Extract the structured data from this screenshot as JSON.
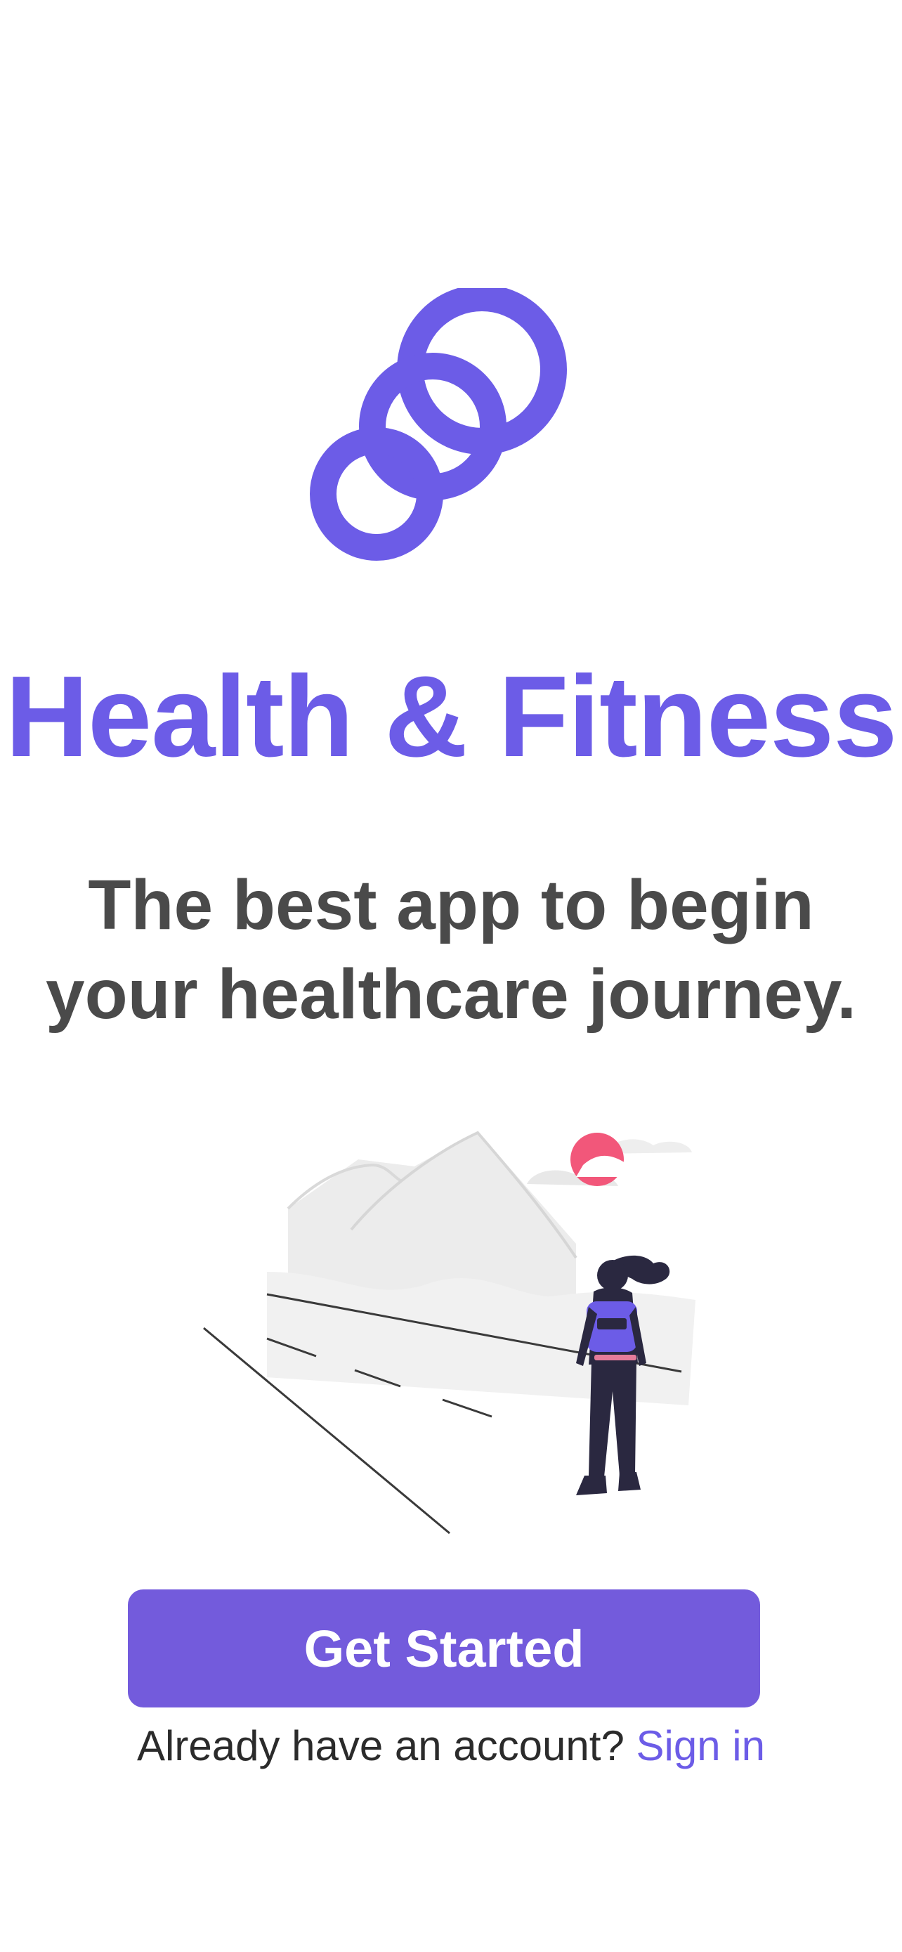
{
  "colors": {
    "brand": "#6c5ce7",
    "button": "#735bdc",
    "tagline": "#4a4a4a",
    "accent_sun": "#f2577a",
    "figure_dark": "#2a2840",
    "background": "#ffffff"
  },
  "logo": {
    "icon": "three-circles-logo-icon"
  },
  "title": "Health & Fitness",
  "tagline": {
    "line1": "The best app to begin",
    "line2": "your healthcare journey."
  },
  "illustration": {
    "icon": "hiker-mountains-illustration"
  },
  "cta": {
    "label": "Get Started"
  },
  "signin": {
    "prompt": "Already have an account?",
    "link": "Sign in"
  }
}
